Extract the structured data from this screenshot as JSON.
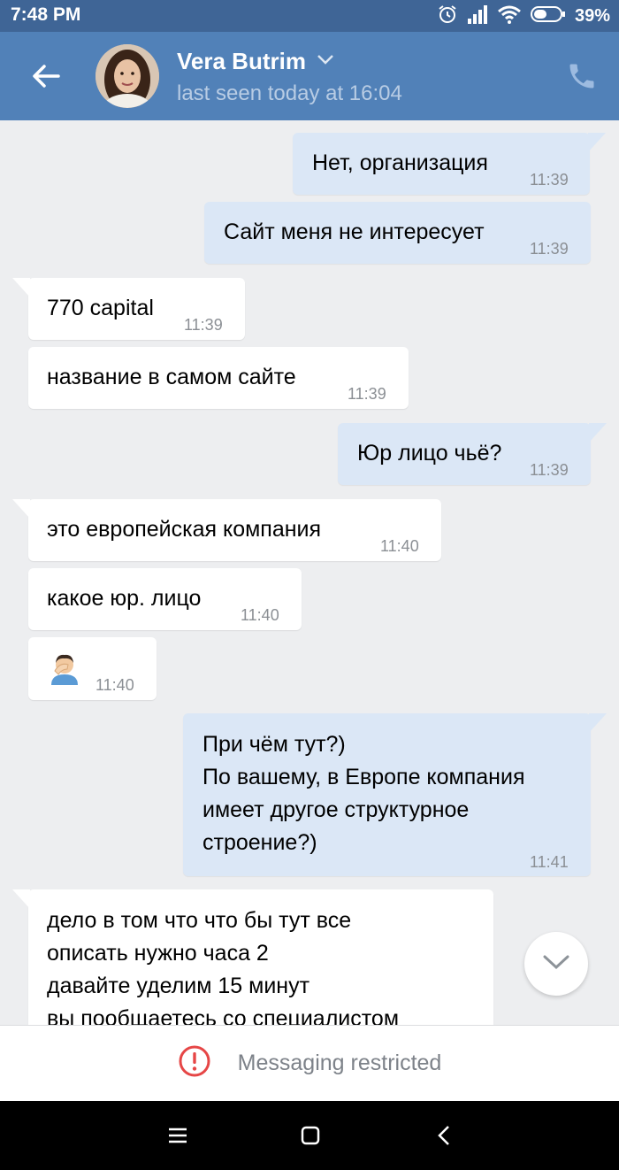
{
  "status_bar": {
    "time": "7:48 PM",
    "battery": "39%",
    "icons": [
      "alarm-icon",
      "signal-icon",
      "wifi-icon",
      "battery-icon"
    ]
  },
  "header": {
    "contact_name": "Vera Butrim",
    "last_seen": "last seen today at 16:04",
    "icons": [
      "back-arrow-icon",
      "chevron-down-icon",
      "phone-icon"
    ]
  },
  "messages": [
    {
      "direction": "out",
      "text": "Нет, организация",
      "time": "11:39"
    },
    {
      "direction": "out",
      "text": "Сайт меня не интересует",
      "time": "11:39"
    },
    {
      "direction": "in",
      "text": "770 capital",
      "time": "11:39"
    },
    {
      "direction": "in",
      "text": "название в самом сайте",
      "time": "11:39"
    },
    {
      "direction": "out",
      "text": "Юр лицо чьё?",
      "time": "11:39"
    },
    {
      "direction": "in",
      "text": "это европейская компания",
      "time": "11:40"
    },
    {
      "direction": "in",
      "text": "какое юр. лицо",
      "time": "11:40"
    },
    {
      "direction": "in",
      "text": "",
      "emoji": "man-facepalming-emoji",
      "time": "11:40"
    },
    {
      "direction": "out",
      "text": "При чём тут?)\nПо вашему, в Европе компания имеет другое структурное строение?)",
      "time": "11:41"
    },
    {
      "direction": "in",
      "text": "дело в том что что бы тут все\nописать нужно часа 2\nдавайте уделим 15 минут\nвы пообщаетесь со специалистом",
      "time": ""
    }
  ],
  "composer": {
    "restricted_label": "Messaging restricted",
    "icon": "error-circle-icon"
  },
  "scroll_button": {
    "icon": "chevron-down-icon"
  },
  "colors": {
    "header": "#5181b8",
    "status_bar": "#3f6596",
    "chat_bg": "#edeef0",
    "outgoing_bubble": "#dbe7f6",
    "incoming_bubble": "#ffffff",
    "error_red": "#e64646"
  },
  "nav_bar": {
    "icons": [
      "menu-icon",
      "home-square-icon",
      "back-chevron-icon"
    ]
  }
}
